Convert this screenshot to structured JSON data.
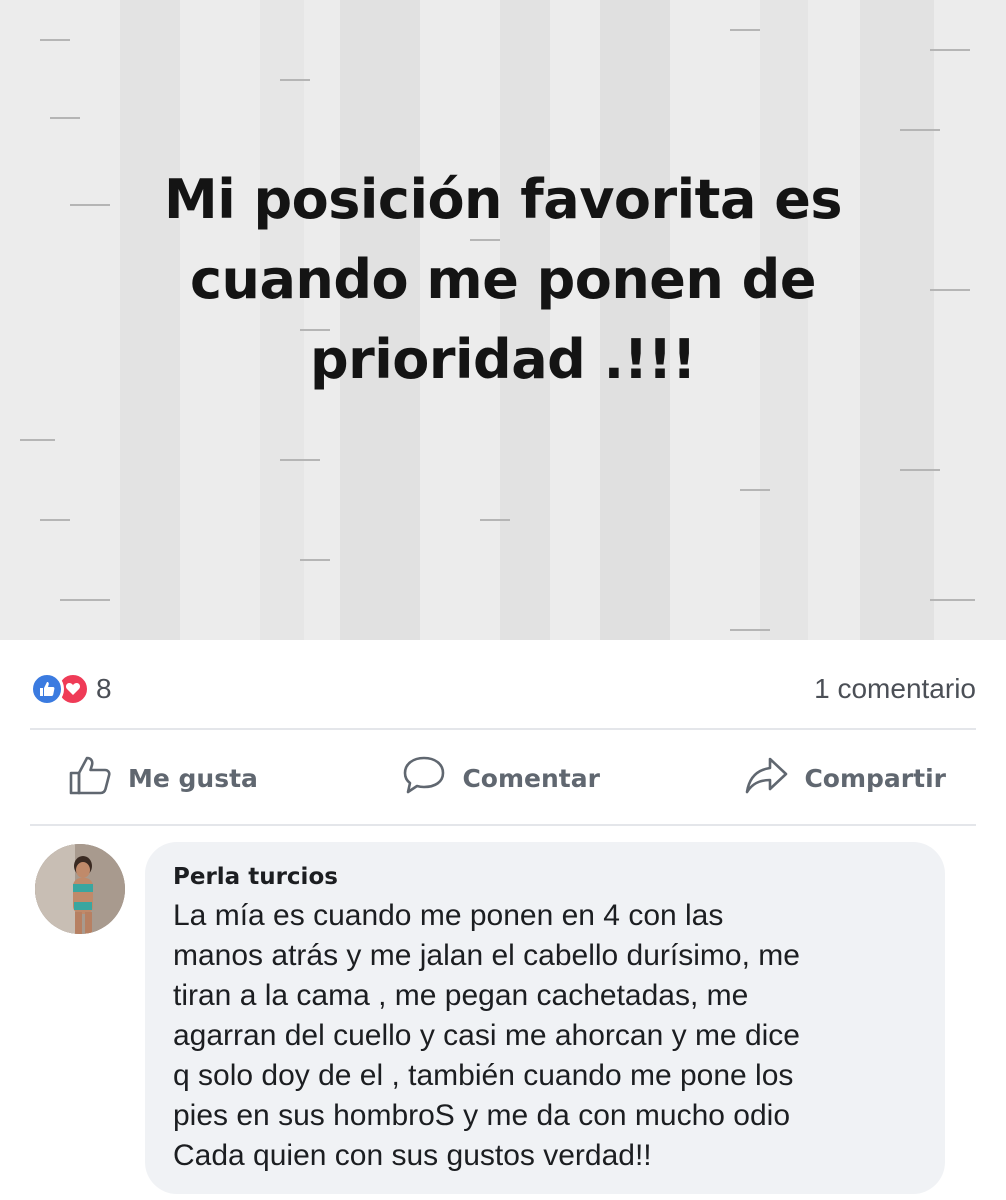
{
  "post": {
    "text": "Mi posición favorita es cuando me ponen de prioridad .!!!"
  },
  "reactions": {
    "icons": [
      "like-icon",
      "love-icon"
    ],
    "count": "8",
    "like_color": "#3b7be0",
    "love_color": "#ef3b57"
  },
  "comments_count": "1 comentario",
  "actions": {
    "like": "Me gusta",
    "comment": "Comentar",
    "share": "Compartir"
  },
  "comment": {
    "author": "Perla turcios",
    "text": "La mía es cuando me ponen en 4 con las\nmanos atrás y me jalan el cabello durísimo, me\ntiran a la cama , me pegan cachetadas, me\nagarran del cuello y casi me ahorcan y me dice\nq solo doy de el , también cuando me pone los\npies en sus hombroS y me da con mucho odio\nCada quien con sus gustos verdad!!"
  }
}
